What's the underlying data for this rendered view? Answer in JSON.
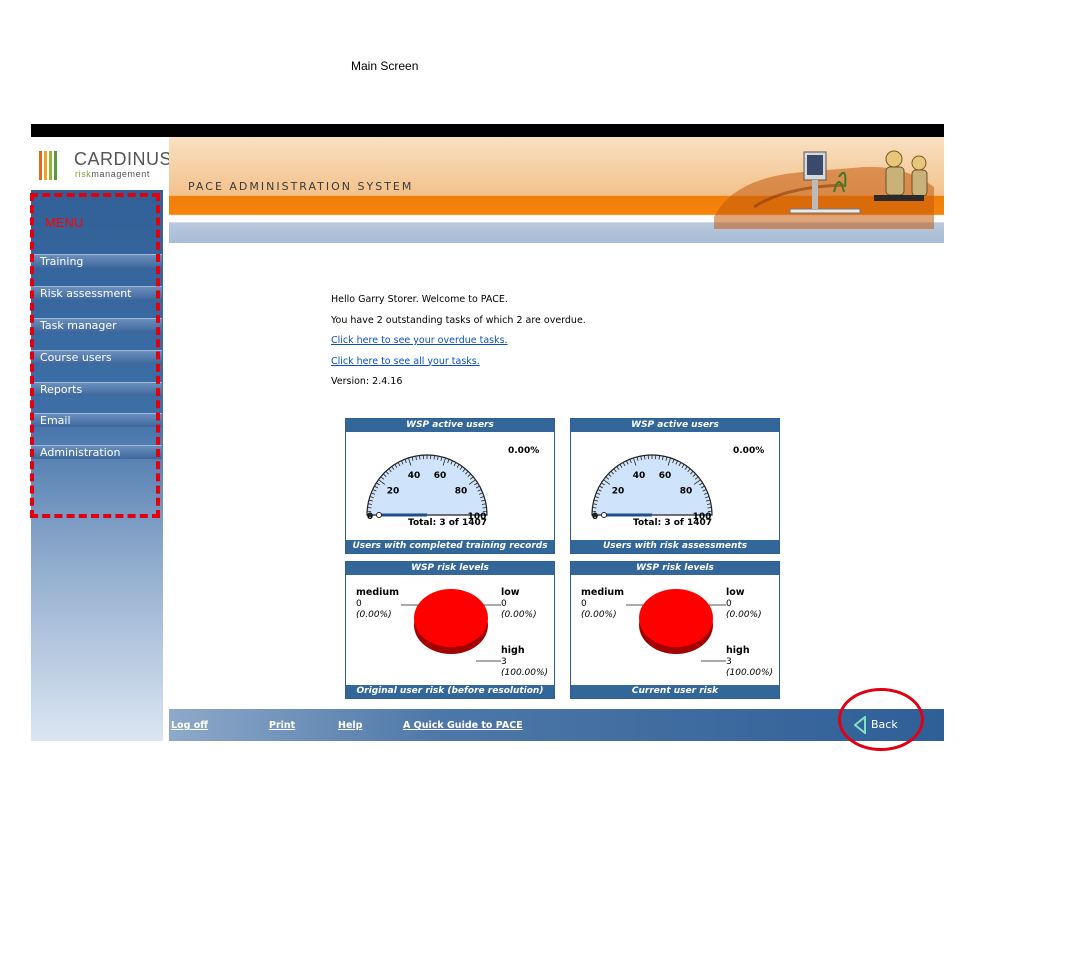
{
  "page_title": "Main Screen",
  "logo": {
    "brand": "CARDINUS",
    "sub_prefix": "risk",
    "sub_suffix": "management",
    "bar_colors": [
      "#e06a1a",
      "#f1a124",
      "#8fb83a",
      "#5a9a3a"
    ]
  },
  "banner": {
    "system_name": "PACE ADMINISTRATION SYSTEM"
  },
  "sidebar": {
    "menu_label": "MENU",
    "items": [
      {
        "label": "Training"
      },
      {
        "label": "Risk assessment"
      },
      {
        "label": "Task manager"
      },
      {
        "label": "Course users"
      },
      {
        "label": "Reports"
      },
      {
        "label": "Email"
      },
      {
        "label": "Administration"
      }
    ]
  },
  "welcome": {
    "greeting": "Hello Garry Storer. Welcome to PACE.",
    "tasks_summary": "You have 2 outstanding tasks of which 2 are overdue.",
    "overdue_link": "Click here to see your overdue tasks.",
    "all_tasks_link": "Click here to see all your tasks.",
    "version": "Version: 2.4.16"
  },
  "gauges": [
    {
      "header": "WSP active users",
      "percent_label": "0.00%",
      "value_percent": 0,
      "total": "Total: 3 of 1407",
      "footer": "Users with completed training records",
      "ticks": [
        "0",
        "20",
        "40",
        "60",
        "80",
        "100"
      ]
    },
    {
      "header": "WSP active users",
      "percent_label": "0.00%",
      "value_percent": 0,
      "total": "Total: 3 of 1407",
      "footer": "Users with risk assessments",
      "ticks": [
        "0",
        "20",
        "40",
        "60",
        "80",
        "100"
      ]
    }
  ],
  "risk_panels": [
    {
      "header": "WSP risk levels",
      "footer": "Original user risk (before resolution)",
      "medium": {
        "label": "medium",
        "count": "0",
        "pct": "(0.00%)"
      },
      "low": {
        "label": "low",
        "count": "0",
        "pct": "(0.00%)"
      },
      "high": {
        "label": "high",
        "count": "3",
        "pct": "(100.00%)"
      }
    },
    {
      "header": "WSP risk levels",
      "footer": "Current user risk",
      "medium": {
        "label": "medium",
        "count": "0",
        "pct": "(0.00%)"
      },
      "low": {
        "label": "low",
        "count": "0",
        "pct": "(0.00%)"
      },
      "high": {
        "label": "high",
        "count": "3",
        "pct": "(100.00%)"
      }
    }
  ],
  "footer": {
    "logoff": "Log off",
    "print": "Print",
    "help": "Help",
    "guide": "A Quick Guide to PACE",
    "back": "Back"
  },
  "colors": {
    "menu_highlight": "#e00010",
    "panel_blue": "#336699",
    "pie_red": "#ff0000",
    "banner_orange": "#f5830c"
  }
}
